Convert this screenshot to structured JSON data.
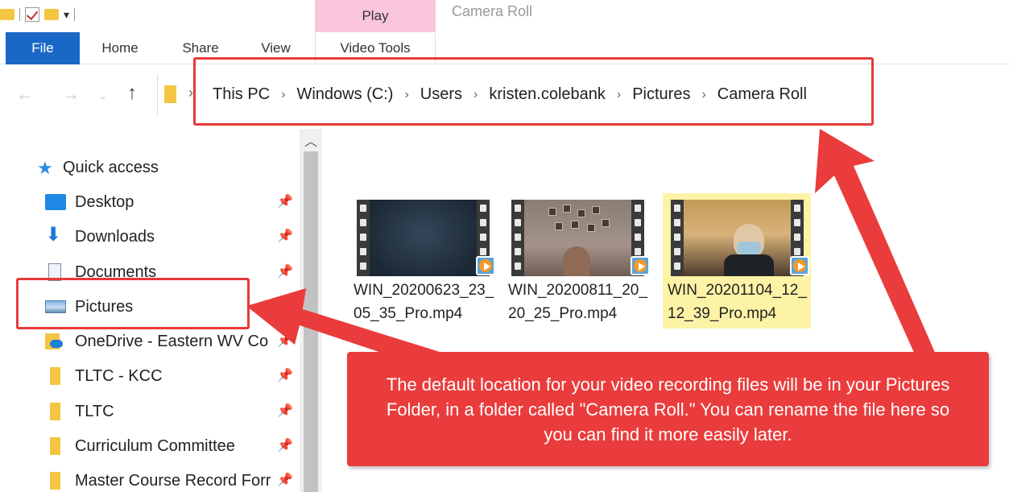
{
  "window": {
    "title": "Camera Roll",
    "context_tab": "Play"
  },
  "ribbon": {
    "tabs": [
      "File",
      "Home",
      "Share",
      "View",
      "Video Tools"
    ]
  },
  "nav": {
    "breadcrumbs": [
      "This PC",
      "Windows (C:)",
      "Users",
      "kristen.colebank",
      "Pictures",
      "Camera Roll"
    ]
  },
  "sidebar": {
    "quick_access": "Quick access",
    "items": [
      {
        "label": "Desktop",
        "icon": "desktop-icon"
      },
      {
        "label": "Downloads",
        "icon": "downloads-icon"
      },
      {
        "label": "Documents",
        "icon": "documents-icon"
      },
      {
        "label": "Pictures",
        "icon": "pictures-icon"
      },
      {
        "label": "OneDrive - Eastern WV Co",
        "icon": "onedrive-icon"
      },
      {
        "label": "TLTC - KCC",
        "icon": "folder-icon"
      },
      {
        "label": "TLTC",
        "icon": "folder-icon"
      },
      {
        "label": "Curriculum Committee",
        "icon": "folder-icon"
      },
      {
        "label": "Master Course Record Forr",
        "icon": "folder-icon"
      }
    ]
  },
  "files": [
    {
      "name": "WIN_20200623_23_05_35_Pro.mp4",
      "selected": false
    },
    {
      "name": "WIN_20200811_20_20_25_Pro.mp4",
      "selected": false
    },
    {
      "name": "WIN_20201104_12_12_39_Pro.mp4",
      "selected": true
    }
  ],
  "annotation": {
    "text": "The default location for your video recording files will be in your Pictures Folder, in a folder called \"Camera Roll.\" You can rename the file here so you can find it more easily later.",
    "color": "#ea3c3c"
  },
  "colors": {
    "file_tab": "#1a68c6",
    "selection": "#fdf3a6",
    "context_tab": "#f9c6dc"
  }
}
